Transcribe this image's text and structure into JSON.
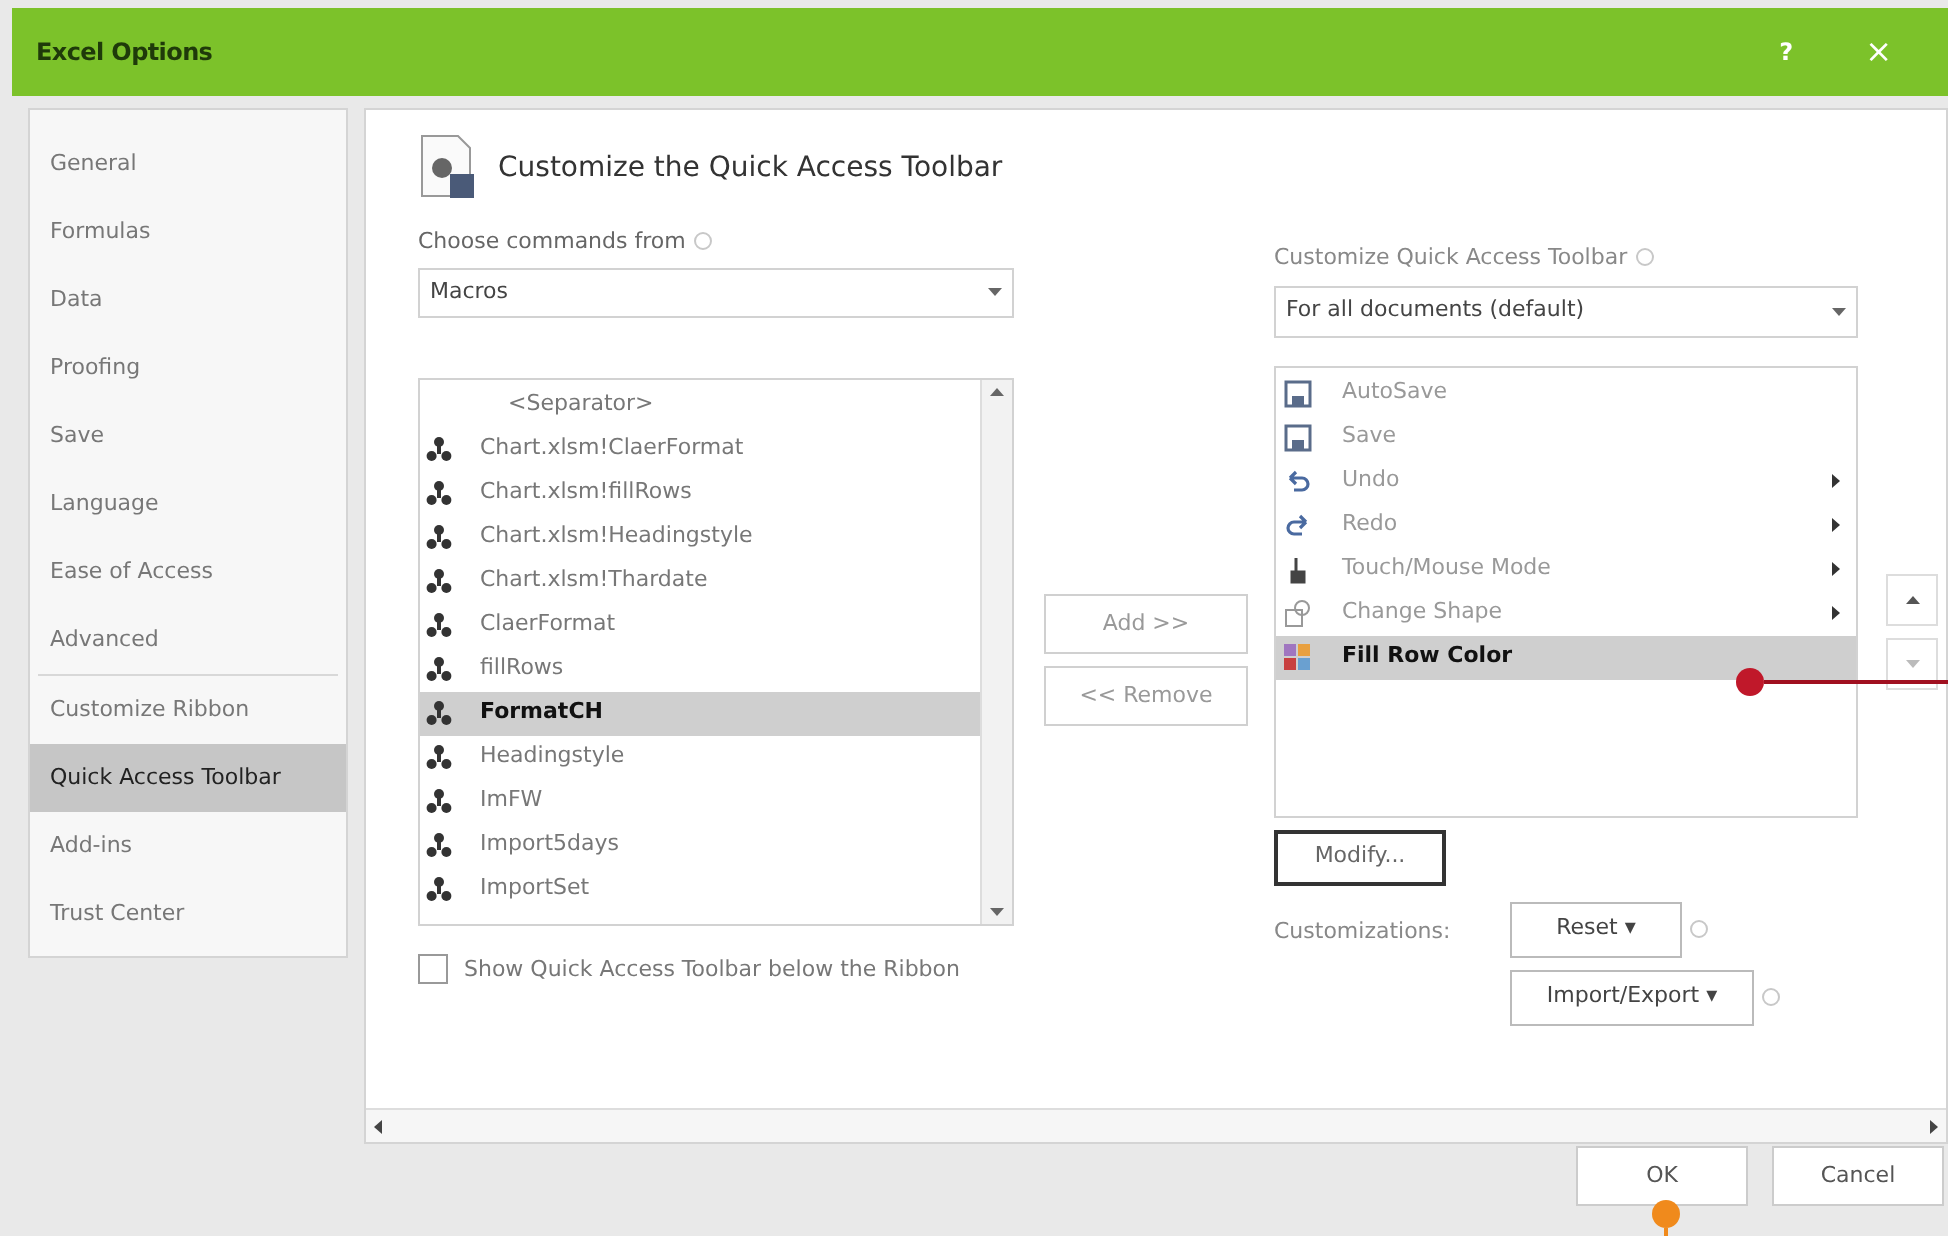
{
  "window": {
    "title": "Excel Options",
    "help": "?",
    "close": "×"
  },
  "sidebar": {
    "items": [
      {
        "label": "General",
        "selected": false
      },
      {
        "label": "Formulas",
        "selected": false
      },
      {
        "label": "Data",
        "selected": false
      },
      {
        "label": "Proofing",
        "selected": false
      },
      {
        "label": "Save",
        "selected": false
      },
      {
        "label": "Language",
        "selected": false
      },
      {
        "label": "Ease of Access",
        "selected": false
      },
      {
        "label": "Advanced",
        "selected": false
      },
      {
        "label": "Customize Ribbon",
        "selected": false
      },
      {
        "label": "Quick Access Toolbar",
        "selected": true
      },
      {
        "label": "Add-ins",
        "selected": false
      },
      {
        "label": "Trust Center",
        "selected": false
      }
    ]
  },
  "heading": "Customize the Quick Access Toolbar",
  "commands": {
    "label": "Choose commands from",
    "value": "Macros",
    "items": [
      {
        "label": "<Separator>",
        "kind": "separator",
        "selected": false
      },
      {
        "label": "Chart.xlsm!ClaerFormat",
        "kind": "macro",
        "selected": false
      },
      {
        "label": "Chart.xlsm!fillRows",
        "kind": "macro",
        "selected": false
      },
      {
        "label": "Chart.xlsm!Headingstyle",
        "kind": "macro",
        "selected": false
      },
      {
        "label": "Chart.xlsm!Thardate",
        "kind": "macro",
        "selected": false
      },
      {
        "label": "ClaerFormat",
        "kind": "macro",
        "selected": false
      },
      {
        "label": "fillRows",
        "kind": "macro",
        "selected": false
      },
      {
        "label": "FormatCH",
        "kind": "macro",
        "selected": true
      },
      {
        "label": "Headingstyle",
        "kind": "macro",
        "selected": false
      },
      {
        "label": "ImFW",
        "kind": "macro",
        "selected": false
      },
      {
        "label": "Import5days",
        "kind": "macro",
        "selected": false
      },
      {
        "label": "ImportSet",
        "kind": "macro",
        "selected": false
      }
    ]
  },
  "show_below": {
    "label": "Show Quick Access Toolbar below the Ribbon",
    "checked": false
  },
  "add_button": "Add >>",
  "remove_button": "<< Remove",
  "toolbar": {
    "label": "Customize Quick Access Toolbar",
    "value": "For all documents (default)",
    "items": [
      {
        "label": "AutoSave",
        "kind": "save",
        "submenu": false,
        "selected": false
      },
      {
        "label": "Save",
        "kind": "save",
        "submenu": false,
        "selected": false
      },
      {
        "label": "Undo",
        "kind": "undo",
        "submenu": true,
        "selected": false
      },
      {
        "label": "Redo",
        "kind": "redo",
        "submenu": true,
        "selected": false
      },
      {
        "label": "Touch/Mouse Mode",
        "kind": "touch",
        "submenu": true,
        "selected": false
      },
      {
        "label": "Change Shape",
        "kind": "shape",
        "submenu": true,
        "selected": false
      },
      {
        "label": "Fill Row Color",
        "kind": "fill",
        "submenu": false,
        "selected": true
      }
    ]
  },
  "modify_button": "Modify...",
  "customizations_label": "Customizations:",
  "reset_button": "Reset ▾",
  "import_export_button": "Import/Export ▾",
  "footer": {
    "ok": "OK",
    "cancel": "Cancel"
  }
}
